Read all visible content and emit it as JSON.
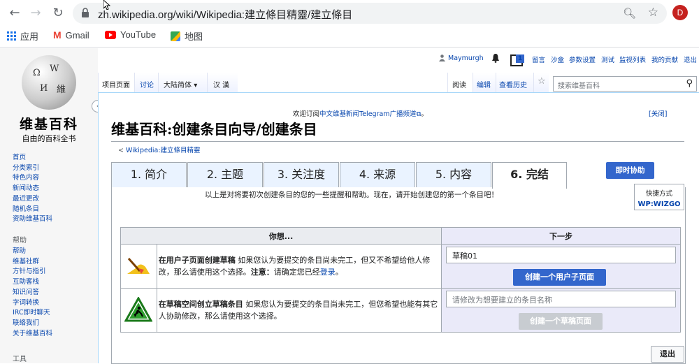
{
  "browser": {
    "url": "zh.wikipedia.org/wiki/Wikipedia:建立條目精靈/建立條目",
    "avatar_letter": "D",
    "bookmarks": [
      {
        "label": "应用",
        "icon": "apps-icon"
      },
      {
        "label": "Gmail",
        "icon": "gmail-icon"
      },
      {
        "label": "YouTube",
        "icon": "youtube-icon"
      },
      {
        "label": "地图",
        "icon": "maps-icon"
      }
    ]
  },
  "personal": {
    "user": "Maymurgh",
    "notice_count": "1",
    "links": [
      "留言",
      "沙盒",
      "参数设置",
      "测试",
      "监视列表",
      "我的贡献",
      "退出"
    ]
  },
  "logo": {
    "title": "维基百科",
    "subtitle": "自由的百科全书"
  },
  "sidebar": {
    "nav": [
      "首页",
      "分类索引",
      "特色内容",
      "新闻动态",
      "最近更改",
      "随机条目",
      "资助维基百科"
    ],
    "help_heading": "帮助",
    "help": [
      "帮助",
      "维基社群",
      "方针与指引",
      "互助客栈",
      "知识问答",
      "字词转换",
      "IRC即时聊天",
      "联络我们",
      "关于维基百科"
    ],
    "tools_heading": "工具"
  },
  "tabs": {
    "project": "项目页面",
    "talk": "讨论",
    "variant": "大陆简体",
    "variant_arrow": "▾",
    "lang": "汉 漢",
    "read": "阅读",
    "edit": "编辑",
    "history": "查看历史",
    "search_placeholder": "搜索维基百科"
  },
  "notice": {
    "prefix": "欢迎订阅",
    "link": "中文维基新闻Telegram广播频道",
    "suffix": "。",
    "dismiss": "[关闭]"
  },
  "page": {
    "title": "维基百科:创建条目向导/创建条目",
    "breadcrumb_prefix": "< ",
    "breadcrumb_link": "Wikipedia:建立條目精靈"
  },
  "wizard": {
    "steps": [
      "1. 简介",
      "2. 主题",
      "3. 关注度",
      "4. 来源",
      "5. 内容",
      "6. 完结"
    ],
    "active_step": 6,
    "help_button": "即时协助",
    "intro": "以上是对将要初次创建条目的您的一些提醒和帮助。现在，请开始创建您的第一个条目吧！",
    "shortcut_label": "快捷方式",
    "shortcut_link": "WP:WIZGO",
    "col_want": "你想...",
    "col_next": "下一步",
    "option1": {
      "bold": "在用户子页面创建草稿",
      "text": " 如果您认为要提交的条目尚未完工，但又不希望给他人修改，那么请使用这个选择。",
      "note_bold": "注意：",
      "note": "请确定您已经",
      "login": "登录",
      "end": "。",
      "input_value": "草稿01",
      "button": "创建一个用户子页面"
    },
    "option2": {
      "bold": "在草稿空间创立草稿条目",
      "text": " 如果您认为要提交的条目尚未完工，但您希望也能有其它人协助修改，那么请使用这个选择。",
      "input_placeholder": "请修改为想要建立的条目名称",
      "button": "创建一个草稿页面"
    },
    "exit": "退出"
  }
}
